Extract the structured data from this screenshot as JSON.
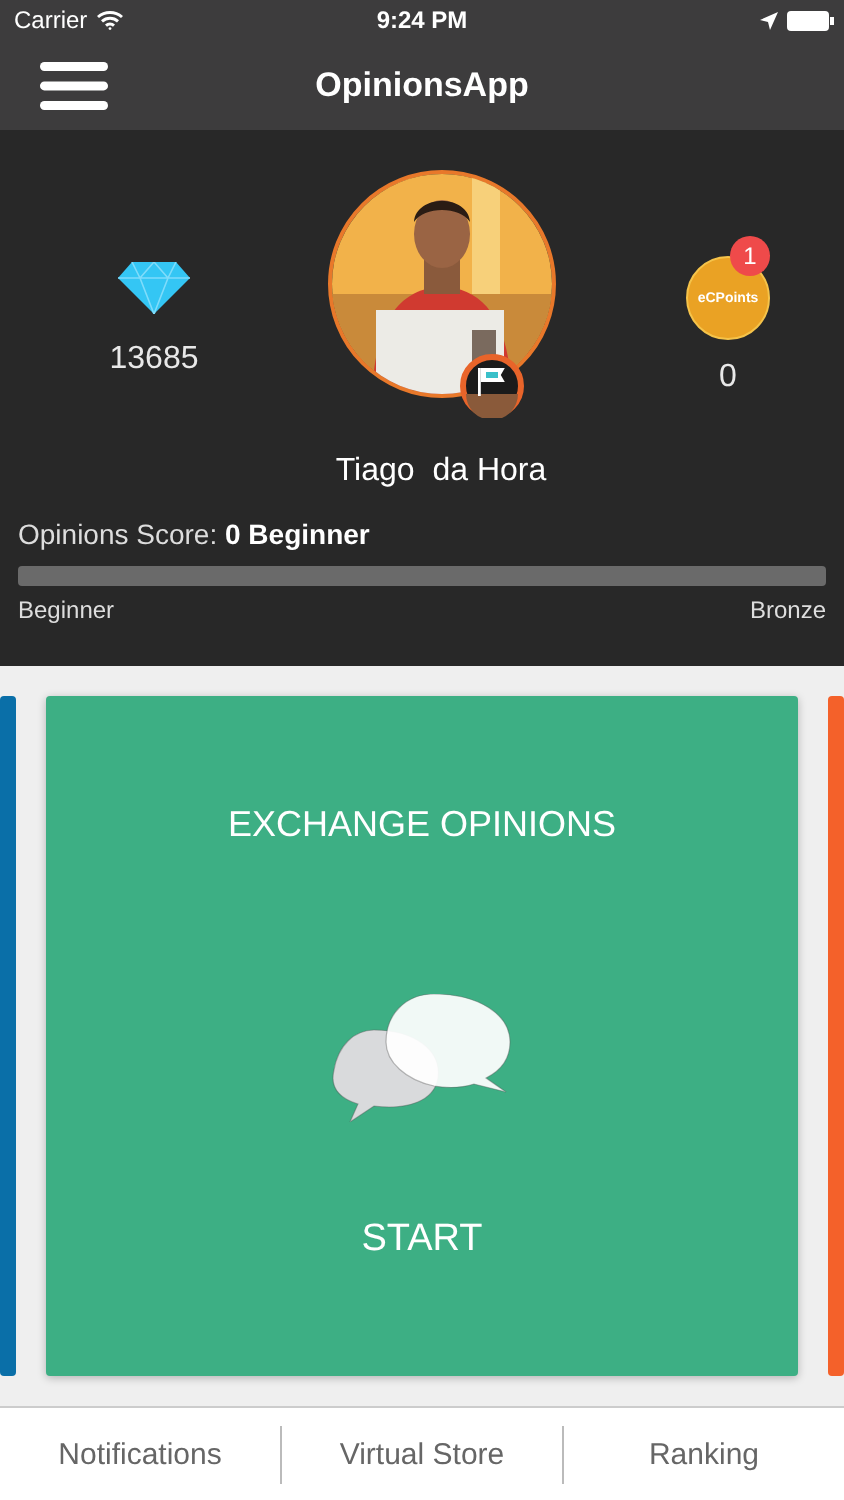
{
  "status_bar": {
    "carrier": "Carrier",
    "time": "9:24 PM"
  },
  "nav_bar": {
    "title": "OpinionsApp"
  },
  "profile": {
    "gems": "13685",
    "name": "Tiago  da Hora",
    "points_badge": {
      "label": "eCPoints",
      "count": "1"
    },
    "points": "0"
  },
  "score": {
    "label": "Opinions Score:",
    "value": "0 Beginner",
    "level": 0,
    "from": "Beginner",
    "to": "Bronze"
  },
  "cards": [
    {
      "kind": "peek",
      "color": "#0a6fa8"
    },
    {
      "kind": "main",
      "color": "#3daf84",
      "title": "EXCHANGE OPINIONS",
      "action": "START"
    },
    {
      "kind": "peek",
      "color": "#f4612a"
    }
  ],
  "tabs": [
    {
      "label": "Notifications"
    },
    {
      "label": "Virtual Store"
    },
    {
      "label": "Ranking"
    }
  ]
}
